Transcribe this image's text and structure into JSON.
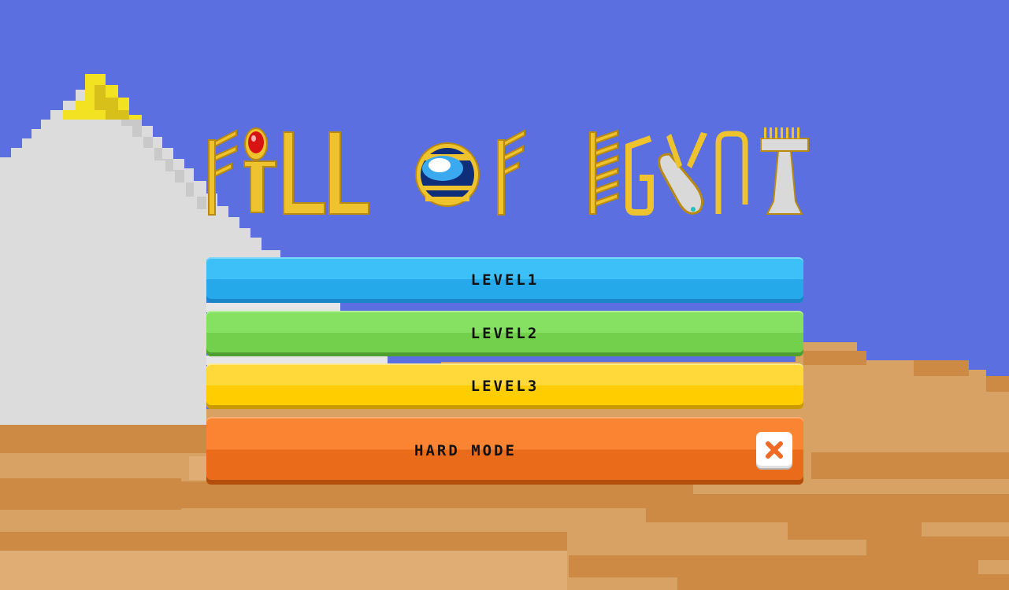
{
  "game": {
    "title": "FILL OF EGYPT"
  },
  "menu": {
    "level1_label": "LEVEL1",
    "level2_label": "LEVEL2",
    "level3_label": "LEVEL3",
    "hard_mode_label": "HARD MODE",
    "hard_mode_enabled": false,
    "hard_mode_toggle_icon": "x-icon"
  },
  "colors": {
    "sky": "#5b6fe0",
    "sand": "#d9a265",
    "pyramid": "#dcdcdc",
    "gold": "#eec22a",
    "level1": "#2aaeec",
    "level2": "#7ad656",
    "level3": "#ffd21a",
    "hard_mode": "#f37626",
    "toggle_x": "#ef6a22"
  }
}
